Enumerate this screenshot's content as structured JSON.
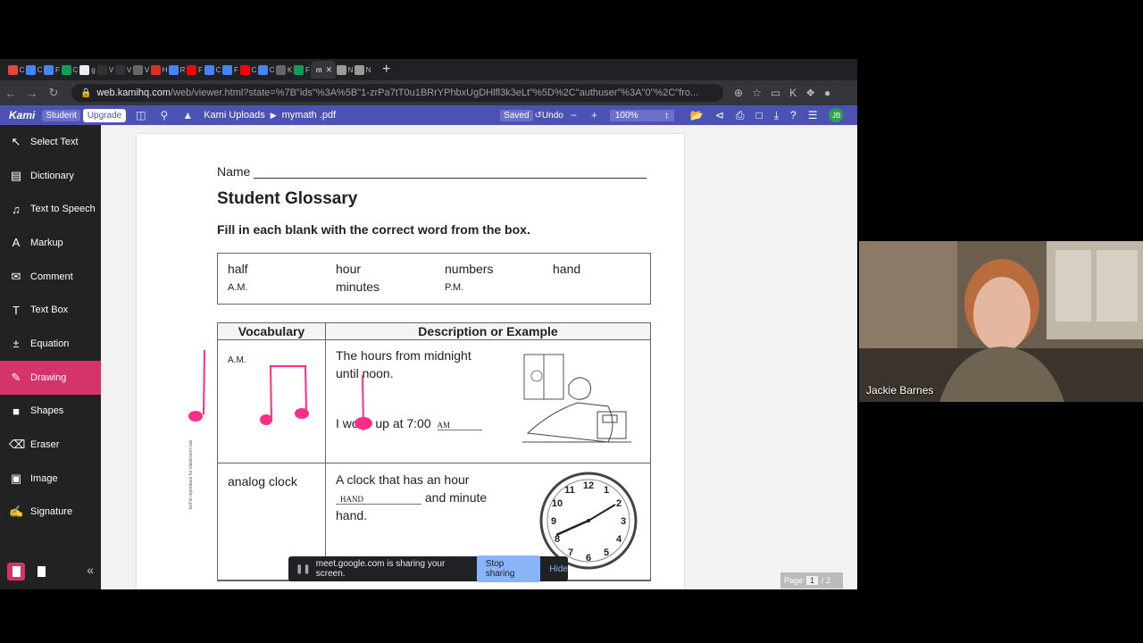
{
  "browser": {
    "tabs": [
      {
        "letter": "C",
        "color": "#e8453c"
      },
      {
        "letter": "C",
        "color": "#4285f4"
      },
      {
        "letter": "F",
        "color": "#4285f4"
      },
      {
        "letter": "C",
        "color": "#0f9d58"
      },
      {
        "letter": "g",
        "color": "#eeeeee"
      },
      {
        "letter": "V",
        "color": "#333333"
      },
      {
        "letter": "V",
        "color": "#333333"
      },
      {
        "letter": "V",
        "color": "#666666"
      },
      {
        "letter": "H",
        "color": "#d93025"
      },
      {
        "letter": "R",
        "color": "#4285f4"
      },
      {
        "letter": "F",
        "color": "#ff0000"
      },
      {
        "letter": "C",
        "color": "#4285f4"
      },
      {
        "letter": "F",
        "color": "#4285f4"
      },
      {
        "letter": "C",
        "color": "#ff0000"
      },
      {
        "letter": "C",
        "color": "#4285f4"
      },
      {
        "letter": "K",
        "color": "#666666"
      },
      {
        "letter": "F",
        "color": "#0f9d58"
      },
      {
        "letter": "N",
        "color": "#999999"
      },
      {
        "letter": "N",
        "color": "#999999"
      }
    ],
    "active_tab_letter": "m",
    "url_host": "web.kamihq.com",
    "url_rest": "/web/viewer.html?state=%7B\"ids\"%3A%5B\"1-zrPa7tT0u1BRrYPhbxUgDHlfl3k3eLt\"%5D%2C\"authuser\"%3A\"0\"%2C\"fro..."
  },
  "kami": {
    "logo": "Kami",
    "student_badge": "Student",
    "upgrade_label": "Upgrade",
    "breadcrumb_folder": "Kami Uploads",
    "breadcrumb_file": "mymath .pdf",
    "saved_label": "Saved",
    "undo_label": "Undo",
    "zoom_level": "100%",
    "avatar_initials": "JB"
  },
  "sidebar": {
    "items": [
      {
        "label": "Select Text",
        "icon": "↖"
      },
      {
        "label": "Dictionary",
        "icon": "▤"
      },
      {
        "label": "Text to Speech",
        "icon": "♫"
      },
      {
        "label": "Markup",
        "icon": "A"
      },
      {
        "label": "Comment",
        "icon": "✉"
      },
      {
        "label": "Text Box",
        "icon": "T"
      },
      {
        "label": "Equation",
        "icon": "±"
      },
      {
        "label": "Drawing",
        "icon": "✎"
      },
      {
        "label": "Shapes",
        "icon": "■"
      },
      {
        "label": "Eraser",
        "icon": "⌫"
      },
      {
        "label": "Image",
        "icon": "▣"
      },
      {
        "label": "Signature",
        "icon": "✍"
      }
    ],
    "active": "Drawing"
  },
  "palette": {
    "size": "2",
    "colors": [
      "#000000",
      "#22c55e",
      "#ff2d8a"
    ]
  },
  "document": {
    "name_label": "Name",
    "title": "Student Glossary",
    "instructions": "Fill in each blank with the correct word from the box.",
    "word_box": {
      "half": "half",
      "am": "A.M.",
      "hour": "hour",
      "minutes": "minutes",
      "numbers": "numbers",
      "pm": "P.M.",
      "hand": "hand"
    },
    "table": {
      "headers": [
        "Vocabulary",
        "Description or Example"
      ],
      "rows": [
        {
          "term": "A.M.",
          "desc1": "The hours from midnight",
          "desc2": "until noon.",
          "example_pre": "I woke up at 7:00",
          "example_answer": "AM"
        },
        {
          "term": "analog clock",
          "desc1": "A clock that has an hour",
          "desc_answer": "HAND",
          "desc2": "and minute",
          "desc3": "hand."
        }
      ]
    },
    "side_note": "ted to reproduce for classroom use."
  },
  "share_banner": {
    "text": "meet.google.com is sharing your screen.",
    "stop_label": "Stop sharing",
    "hide_label": "Hide"
  },
  "page_indicator": {
    "label": "Page",
    "current": "1",
    "total": "/ 2"
  },
  "webcam": {
    "participant_name": "Jackie Barnes"
  }
}
